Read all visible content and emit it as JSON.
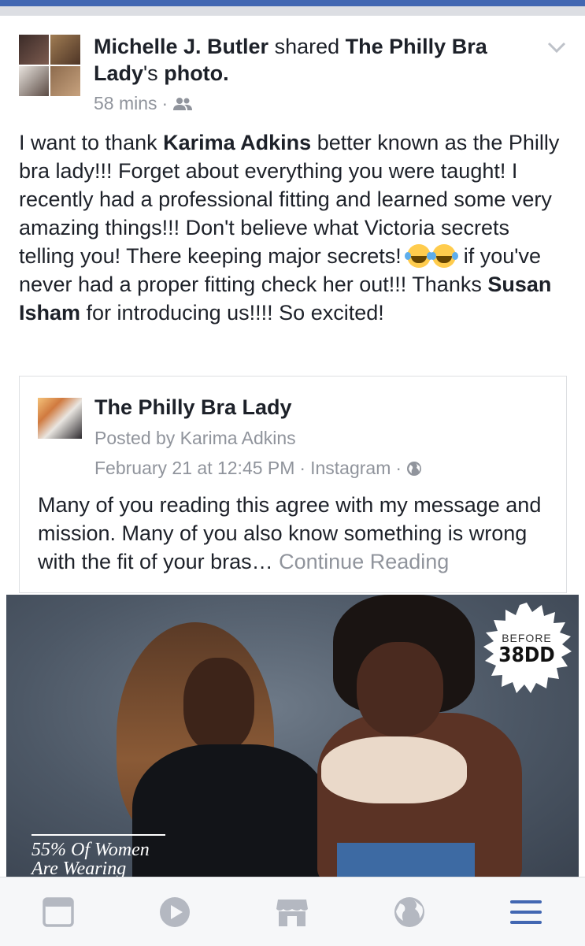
{
  "header": {
    "sharer_name": "Michelle J. Butler",
    "action": "shared",
    "shared_page": "The Philly Bra Lady",
    "possessive": "'s",
    "object": "photo.",
    "time": "58 mins",
    "separator": "·",
    "audience_icon": "friends-icon"
  },
  "post": {
    "p1": "I want to thank ",
    "mention1": "Karima Adkins",
    "p2": " better known as the Philly bra lady!!! Forget about everything you were taught! I recently had a professional fitting and learned some very amazing things!!! Don't believe what Victoria secrets telling you! There keeping major secrets! ",
    "emoji": "face-with-tears-of-joy",
    "p3": " if you've never had a proper fitting check her out!!! Thanks ",
    "mention2": "Susan Isham",
    "p4": " for introducing us!!!! So excited!"
  },
  "shared_card": {
    "page_name": "The Philly Bra Lady",
    "posted_by": "Posted by Karima Adkins",
    "date": "February 21 at 12:45 PM",
    "sep1": "·",
    "source": "Instagram",
    "sep2": "·",
    "privacy_icon": "globe-icon",
    "body": "Many of you reading this agree with my message and mission. Many of you also know something is wrong with the fit of your bras…",
    "continue": " Continue Reading"
  },
  "photo": {
    "badge_top": "BEFORE",
    "badge_main": "38DD",
    "overlay_line1": "55% Of Women",
    "overlay_line2": "Are Wearing"
  },
  "bottom_nav": {
    "items": [
      "news-feed-icon",
      "video-icon",
      "marketplace-icon",
      "notifications-globe-icon",
      "menu-icon"
    ],
    "active_color": "#4267b2",
    "inactive_color": "#b4b8c1"
  }
}
